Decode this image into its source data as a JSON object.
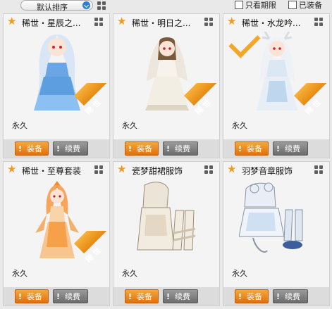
{
  "toolbar": {
    "sort_label": "默认排序",
    "only_expiring_label": "只看期限",
    "equipped_label": "已装备"
  },
  "badge_text": "稀世",
  "items": [
    {
      "title": "稀世・星辰之...",
      "duration": "永久",
      "equip_label": "装备",
      "renew_label": "续费",
      "rare": true,
      "equipped": false
    },
    {
      "title": "稀世・明日之...",
      "duration": "永久",
      "equip_label": "装备",
      "renew_label": "续费",
      "rare": true,
      "equipped": false
    },
    {
      "title": "稀世・水龙吟...",
      "duration": "永久",
      "equip_label": "装备",
      "renew_label": "续费",
      "rare": true,
      "equipped": true
    },
    {
      "title": "稀世・至尊套装",
      "duration": "永久",
      "equip_label": "装备",
      "renew_label": "续费",
      "rare": true,
      "equipped": false
    },
    {
      "title": "瓷梦甜裙服饰",
      "duration": "永久",
      "equip_label": "装备",
      "renew_label": "续费",
      "rare": false,
      "equipped": false
    },
    {
      "title": "羽梦音章服饰",
      "duration": "永久",
      "equip_label": "装备",
      "renew_label": "续费",
      "rare": false,
      "equipped": false
    }
  ],
  "colors": {
    "accent": "#f29a1a",
    "button_orange": "#e0700d",
    "button_gray": "#6c6c6c"
  }
}
